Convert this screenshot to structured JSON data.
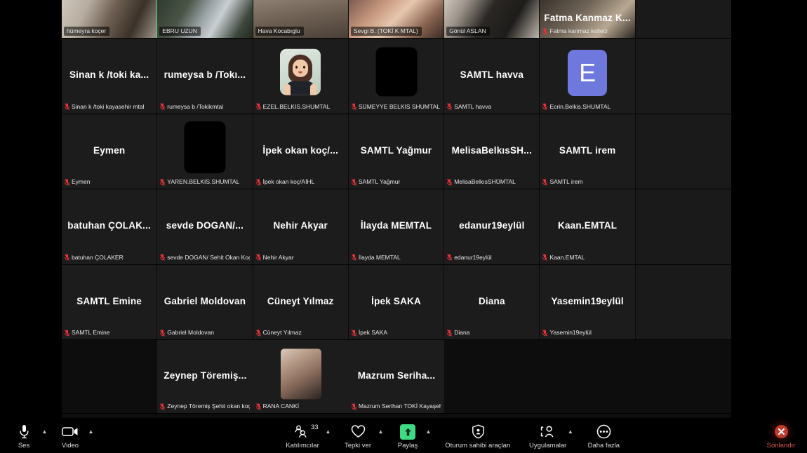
{
  "meeting": {
    "participant_count": "33",
    "active_speaker": "hümeyra koçer"
  },
  "gallery": {
    "rows": [
      {
        "row_type": "top-partial",
        "tiles": [
          {
            "kind": "video",
            "video": "vid-hk",
            "big_name": "",
            "label": "hümeyra koçer",
            "muted": false,
            "speaking": true,
            "pill": true
          },
          {
            "kind": "video",
            "video": "vid-e1",
            "big_name": "",
            "label": "EBRU UZUN",
            "muted": false,
            "speaking": false,
            "pill": true
          },
          {
            "kind": "video",
            "video": "vid-h1b",
            "big_name": "",
            "label": "Hava Kocabıglu",
            "muted": false,
            "speaking": false,
            "pill": true
          },
          {
            "kind": "video",
            "video": "vid-sv",
            "big_name": "",
            "label": "Sevgi B. (TOKİ K MTAL)",
            "muted": false,
            "speaking": false,
            "pill": true
          },
          {
            "kind": "video",
            "video": "vid-ga",
            "big_name": "",
            "label": "Gönül ASLAN",
            "muted": false,
            "speaking": false,
            "pill": true
          },
          {
            "kind": "video",
            "video": "vid-fk",
            "big_name": "Fatma Kanmaz K...",
            "label": "Fatma kanmaz kelleci",
            "muted": true,
            "speaking": false,
            "pill": false
          }
        ]
      },
      {
        "row_type": "normal",
        "tiles": [
          {
            "kind": "name",
            "big_name": "Sinan k /toki ka...",
            "label": "Sinan k /toki kayasehir mtal",
            "muted": true
          },
          {
            "kind": "name",
            "big_name": "rumeysa b /Tokı...",
            "label": "rumeysa b /Tokikmtal",
            "muted": true
          },
          {
            "kind": "memoji",
            "big_name": "",
            "label": "EZEL.BELKIS.SHUMTAL",
            "muted": true
          },
          {
            "kind": "blackbox",
            "big_name": "",
            "label": "SÜMEYYE BELKIS SHUMTAL",
            "muted": true
          },
          {
            "kind": "name",
            "big_name": "SAMTL havva",
            "label": "SAMTL havva",
            "muted": true
          },
          {
            "kind": "avatar",
            "avatar_letter": "E",
            "avatar_color": "#6f78dd",
            "big_name": "",
            "label": "Ecrin.Belkis.SHUMTAL",
            "muted": true
          }
        ]
      },
      {
        "row_type": "normal",
        "tiles": [
          {
            "kind": "name",
            "big_name": "Eymen",
            "label": "Eymen",
            "muted": true
          },
          {
            "kind": "blackbox",
            "big_name": "",
            "label": "YAREN.BELKIS.SHUMTAL",
            "muted": true
          },
          {
            "kind": "name",
            "big_name": "İpek okan koç/...",
            "label": "İpek okan koç/AİHL",
            "muted": true
          },
          {
            "kind": "name",
            "big_name": "SAMTL Yağmur",
            "label": "SAMTL Yağmur",
            "muted": true
          },
          {
            "kind": "name",
            "big_name": "MelisaBelkısSH...",
            "label": "MelisaBelkısSHÜMTAL",
            "muted": true
          },
          {
            "kind": "name",
            "big_name": "SAMTL irem",
            "label": "SAMTL irem",
            "muted": true
          }
        ]
      },
      {
        "row_type": "normal",
        "tiles": [
          {
            "kind": "name",
            "big_name": "batuhan ÇOLAK...",
            "label": "batuhan ÇOLAKER",
            "muted": true
          },
          {
            "kind": "name",
            "big_name": "sevde DOGAN/...",
            "label": "sevde DOGAN/ Sehit Okan Koç ...",
            "muted": true
          },
          {
            "kind": "name",
            "big_name": "Nehir Akyar",
            "label": "Nehir Akyar",
            "muted": true
          },
          {
            "kind": "name",
            "big_name": "İlayda MEMTAL",
            "label": "İlayda MEMTAL",
            "muted": true
          },
          {
            "kind": "name",
            "big_name": "edanur19eylül",
            "label": "edanur19eylül",
            "muted": true
          },
          {
            "kind": "name",
            "big_name": "Kaan.EMTAL",
            "label": "Kaan.EMTAL",
            "muted": true
          }
        ]
      },
      {
        "row_type": "normal",
        "tiles": [
          {
            "kind": "name",
            "big_name": "SAMTL Emine",
            "label": "SAMTL Emine",
            "muted": true
          },
          {
            "kind": "name",
            "big_name": "Gabriel Moldovan",
            "label": "Gabriel Moldovan",
            "muted": true
          },
          {
            "kind": "name",
            "big_name": "Cüneyt Yılmaz",
            "label": "Cüneyt Yılmaz",
            "muted": true
          },
          {
            "kind": "name",
            "big_name": "İpek SAKA",
            "label": "İpek SAKA",
            "muted": true
          },
          {
            "kind": "name",
            "big_name": "Diana",
            "label": "Diana",
            "muted": true
          },
          {
            "kind": "name",
            "big_name": "Yasemin19eylül",
            "label": "Yasemin19eylül",
            "muted": true
          }
        ]
      },
      {
        "row_type": "last-partial",
        "tiles": [
          {
            "kind": "empty"
          },
          {
            "kind": "name",
            "big_name": "Zeynep Töremiş...",
            "label": "Zeynep Töremiş Şehit okan koç",
            "muted": true
          },
          {
            "kind": "thumb",
            "big_name": "",
            "label": "RANA CANKİ",
            "muted": true
          },
          {
            "kind": "name",
            "big_name": "Mazrum Seriha...",
            "label": "Mazrum Serihan TOKİ Kayaşehi...",
            "muted": true
          },
          {
            "kind": "empty"
          },
          {
            "kind": "empty"
          }
        ]
      }
    ]
  },
  "toolbar": {
    "audio": {
      "label": "Ses",
      "icon": "microphone-icon"
    },
    "video": {
      "label": "Video",
      "icon": "camera-icon"
    },
    "participants": {
      "label": "Katılımcılar",
      "count": "33",
      "icon": "participants-icon"
    },
    "reactions": {
      "label": "Tepki ver",
      "icon": "heart-icon"
    },
    "share": {
      "label": "Paylaş",
      "icon": "share-screen-icon",
      "color": "#3ddc84"
    },
    "host_tools": {
      "label": "Oturum sahibi araçları",
      "icon": "shield-icon"
    },
    "apps": {
      "label": "Uygulamalar",
      "icon": "apps-icon"
    },
    "more": {
      "label": "Daha fazla",
      "icon": "ellipsis-icon"
    },
    "end": {
      "label": "Sonlandır",
      "icon": "end-call-icon",
      "color": "#e05757"
    }
  }
}
